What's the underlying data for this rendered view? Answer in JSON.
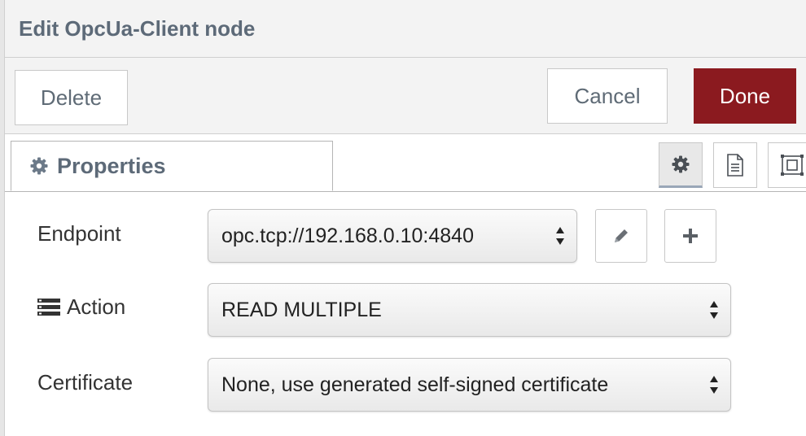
{
  "dialog": {
    "title": "Edit OpcUa-Client node"
  },
  "toolbar": {
    "delete_label": "Delete",
    "cancel_label": "Cancel",
    "done_label": "Done"
  },
  "tabs": {
    "properties_label": "Properties",
    "icons": [
      "gear-icon",
      "description-icon",
      "appearance-icon"
    ]
  },
  "form": {
    "endpoint": {
      "label": "Endpoint",
      "value": "opc.tcp://192.168.0.10:4840"
    },
    "action": {
      "label": "Action",
      "value": "READ MULTIPLE"
    },
    "certificate": {
      "label": "Certificate",
      "value": "None, use generated self-signed certificate"
    }
  },
  "colors": {
    "accent": "#8b1a1f",
    "title_text": "#5d6a78",
    "header_bg": "#f3f3f3"
  }
}
